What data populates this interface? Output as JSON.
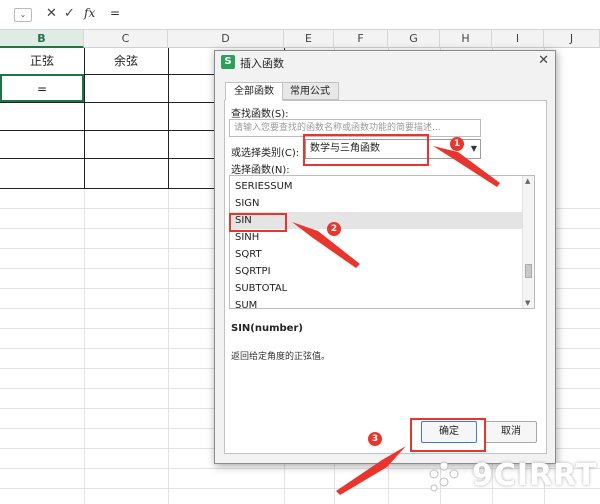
{
  "formula_bar": {
    "name_box_dropdown": "⌄",
    "cancel_icon": "✕",
    "confirm_icon": "✓",
    "fx_label": "fx",
    "value": "="
  },
  "sheet": {
    "columns": [
      "B",
      "C",
      "D",
      "E",
      "F",
      "G",
      "H",
      "I",
      "J"
    ],
    "active_column": "B",
    "cells": {
      "b_header": "正弦",
      "c_header": "余弦",
      "b_value": "="
    }
  },
  "dialog": {
    "title": "插入函数",
    "logo": "S",
    "close": "✕",
    "tabs": [
      "全部函数",
      "常用公式"
    ],
    "search_label": "查找函数(S):",
    "search_placeholder": "请输入您要查找的函数名称或函数功能的简要描述...",
    "category_label": "或选择类别(C):",
    "category_value": "数学与三角函数",
    "category_arrow": "▼",
    "list_label": "选择函数(N):",
    "functions": [
      "SERIESSUM",
      "SIGN",
      "SIN",
      "SINH",
      "SQRT",
      "SQRTPI",
      "SUBTOTAL",
      "SUM"
    ],
    "selected_function": "SIN",
    "signature": "SIN(number)",
    "description": "返回给定角度的正弦值。",
    "ok_label": "确定",
    "cancel_label": "取消",
    "scroll_up": "▲",
    "scroll_down": "▼"
  },
  "annotations": {
    "badges": [
      "1",
      "2",
      "3"
    ]
  },
  "watermark": {
    "text": "9CIRRT"
  },
  "colors": {
    "annotation": "#e8352e",
    "accent": "#217346",
    "ok_border": "#3a7bd5"
  }
}
